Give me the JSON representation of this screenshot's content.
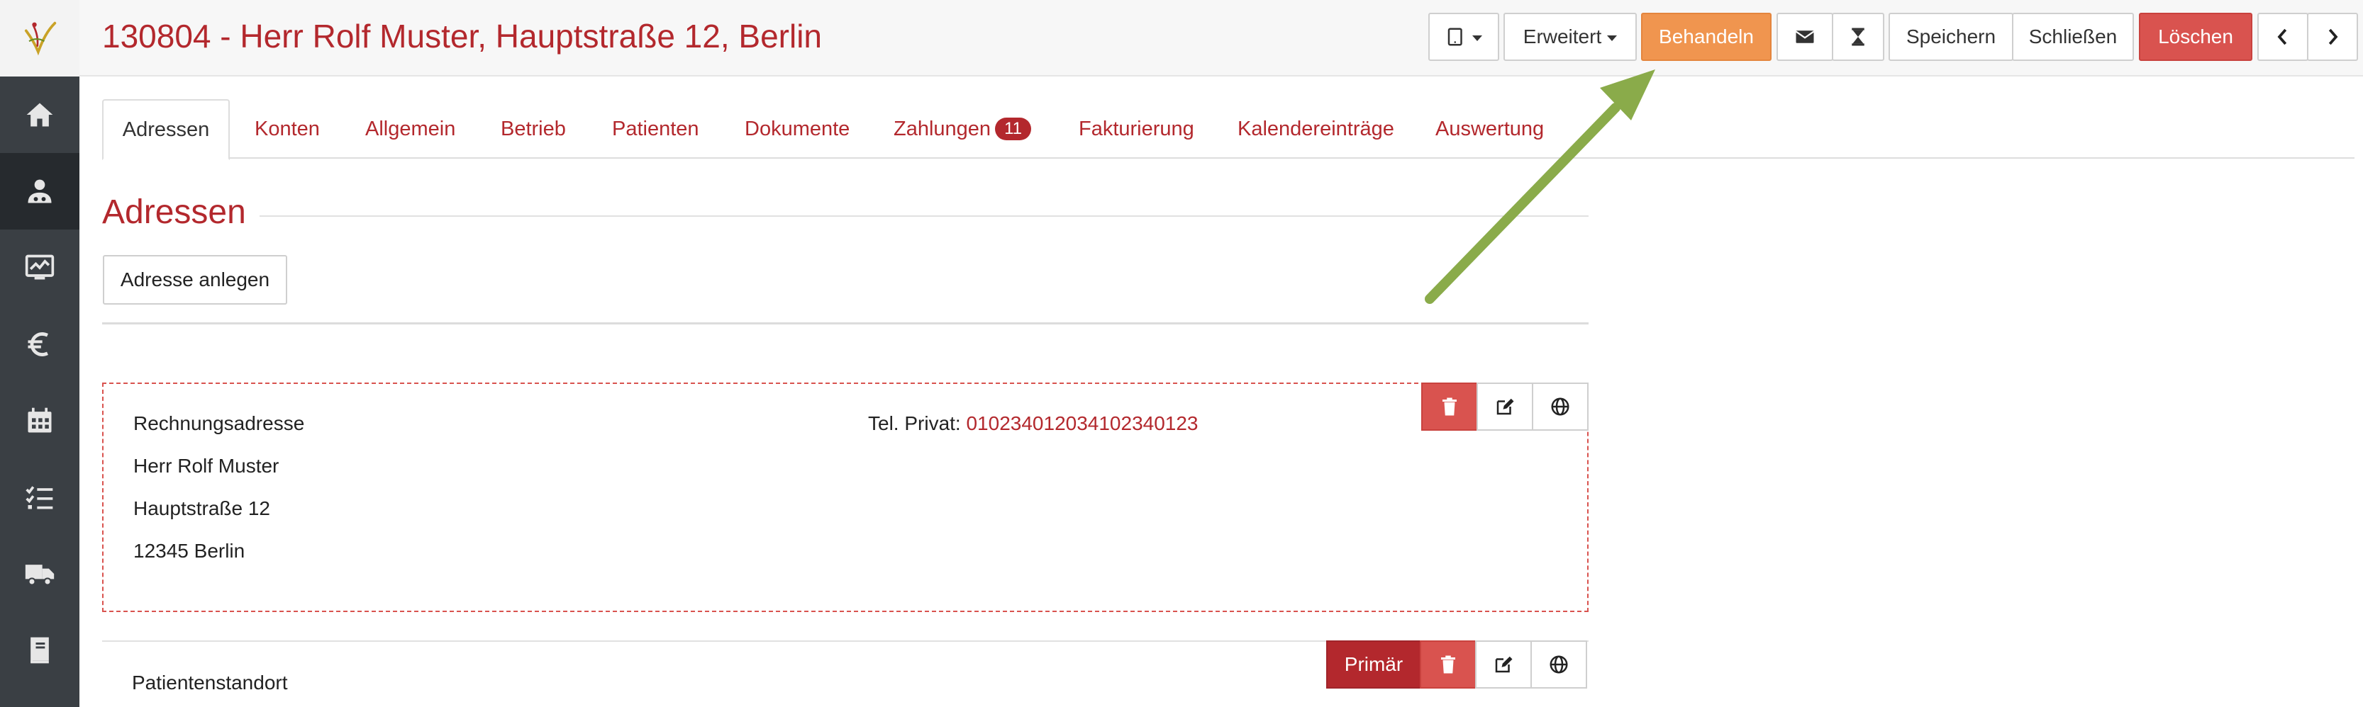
{
  "window": {
    "title": "130804 - Herr Rolf Muster, Hauptstraße 12, Berlin"
  },
  "sidebar": {
    "items": [
      {
        "icon": "home-icon"
      },
      {
        "icon": "users-icon",
        "active": true
      },
      {
        "icon": "monitor-chart-icon"
      },
      {
        "icon": "euro-icon"
      },
      {
        "icon": "calendar-icon"
      },
      {
        "icon": "checklist-icon"
      },
      {
        "icon": "truck-icon"
      },
      {
        "icon": "book-icon"
      }
    ]
  },
  "toolbar": {
    "extended_label": "Erweitert",
    "treat_label": "Behandeln",
    "save_label": "Speichern",
    "close_label": "Schließen",
    "delete_label": "Löschen"
  },
  "tabs": [
    {
      "label": "Adressen",
      "active": true
    },
    {
      "label": "Konten"
    },
    {
      "label": "Allgemein"
    },
    {
      "label": "Betrieb"
    },
    {
      "label": "Patienten"
    },
    {
      "label": "Dokumente"
    },
    {
      "label": "Zahlungen",
      "badge": "11"
    },
    {
      "label": "Fakturierung"
    },
    {
      "label": "Kalendereinträge"
    },
    {
      "label": "Auswertung"
    }
  ],
  "section": {
    "title": "Adressen",
    "add_label": "Adresse anlegen"
  },
  "addresses": [
    {
      "type": "Rechnungsadresse",
      "name": "Herr Rolf Muster",
      "street": "Hauptstraße 12",
      "city": "12345 Berlin",
      "phone_label": "Tel. Privat:",
      "phone": "010234012034102340123"
    },
    {
      "type": "Patientenstandort",
      "primary_label": "Primär"
    }
  ],
  "colors": {
    "brand": "#b3282d",
    "orange": "#f0954f",
    "danger": "#d9534f",
    "arrow": "#8aab4a",
    "sidebar": "#3a3f44"
  }
}
